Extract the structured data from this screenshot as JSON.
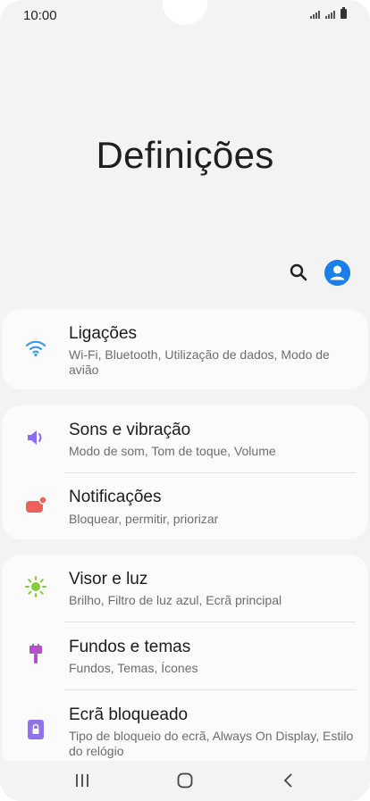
{
  "status_bar": {
    "time": "10:00"
  },
  "header": {
    "title": "Definições"
  },
  "toolbar": {
    "search_icon": "search-icon",
    "avatar_icon": "account-icon"
  },
  "colors": {
    "accent": "#1a7fe6",
    "connections_icon": "#3d9ae8",
    "sounds_icon": "#8a6cf0",
    "notifications_icon": "#f0605a",
    "display_icon": "#86c93b",
    "themes_icon": "#b34fc9",
    "lockscreen_icon": "#8f73e8"
  },
  "groups": [
    {
      "items": [
        {
          "title": "Ligações",
          "subtitle": "Wi-Fi, Bluetooth, Utilização de dados, Modo de avião",
          "icon": "wifi-icon"
        }
      ]
    },
    {
      "items": [
        {
          "title": "Sons e vibração",
          "subtitle": "Modo de som, Tom de toque, Volume",
          "icon": "speaker-icon"
        },
        {
          "title": "Notificações",
          "subtitle": "Bloquear, permitir, priorizar",
          "icon": "notification-icon"
        }
      ]
    },
    {
      "items": [
        {
          "title": "Visor e luz",
          "subtitle": "Brilho, Filtro de luz azul, Ecrã principal",
          "icon": "sun-icon"
        },
        {
          "title": "Fundos e temas",
          "subtitle": "Fundos, Temas, Ícones",
          "icon": "brush-icon"
        },
        {
          "title": "Ecrã bloqueado",
          "subtitle": "Tipo de bloqueio do ecrã, Always On Display, Estilo do relógio",
          "icon": "lock-icon"
        }
      ]
    }
  ],
  "navbar": {
    "recent": "recent-apps-icon",
    "home": "home-icon",
    "back": "back-icon"
  }
}
